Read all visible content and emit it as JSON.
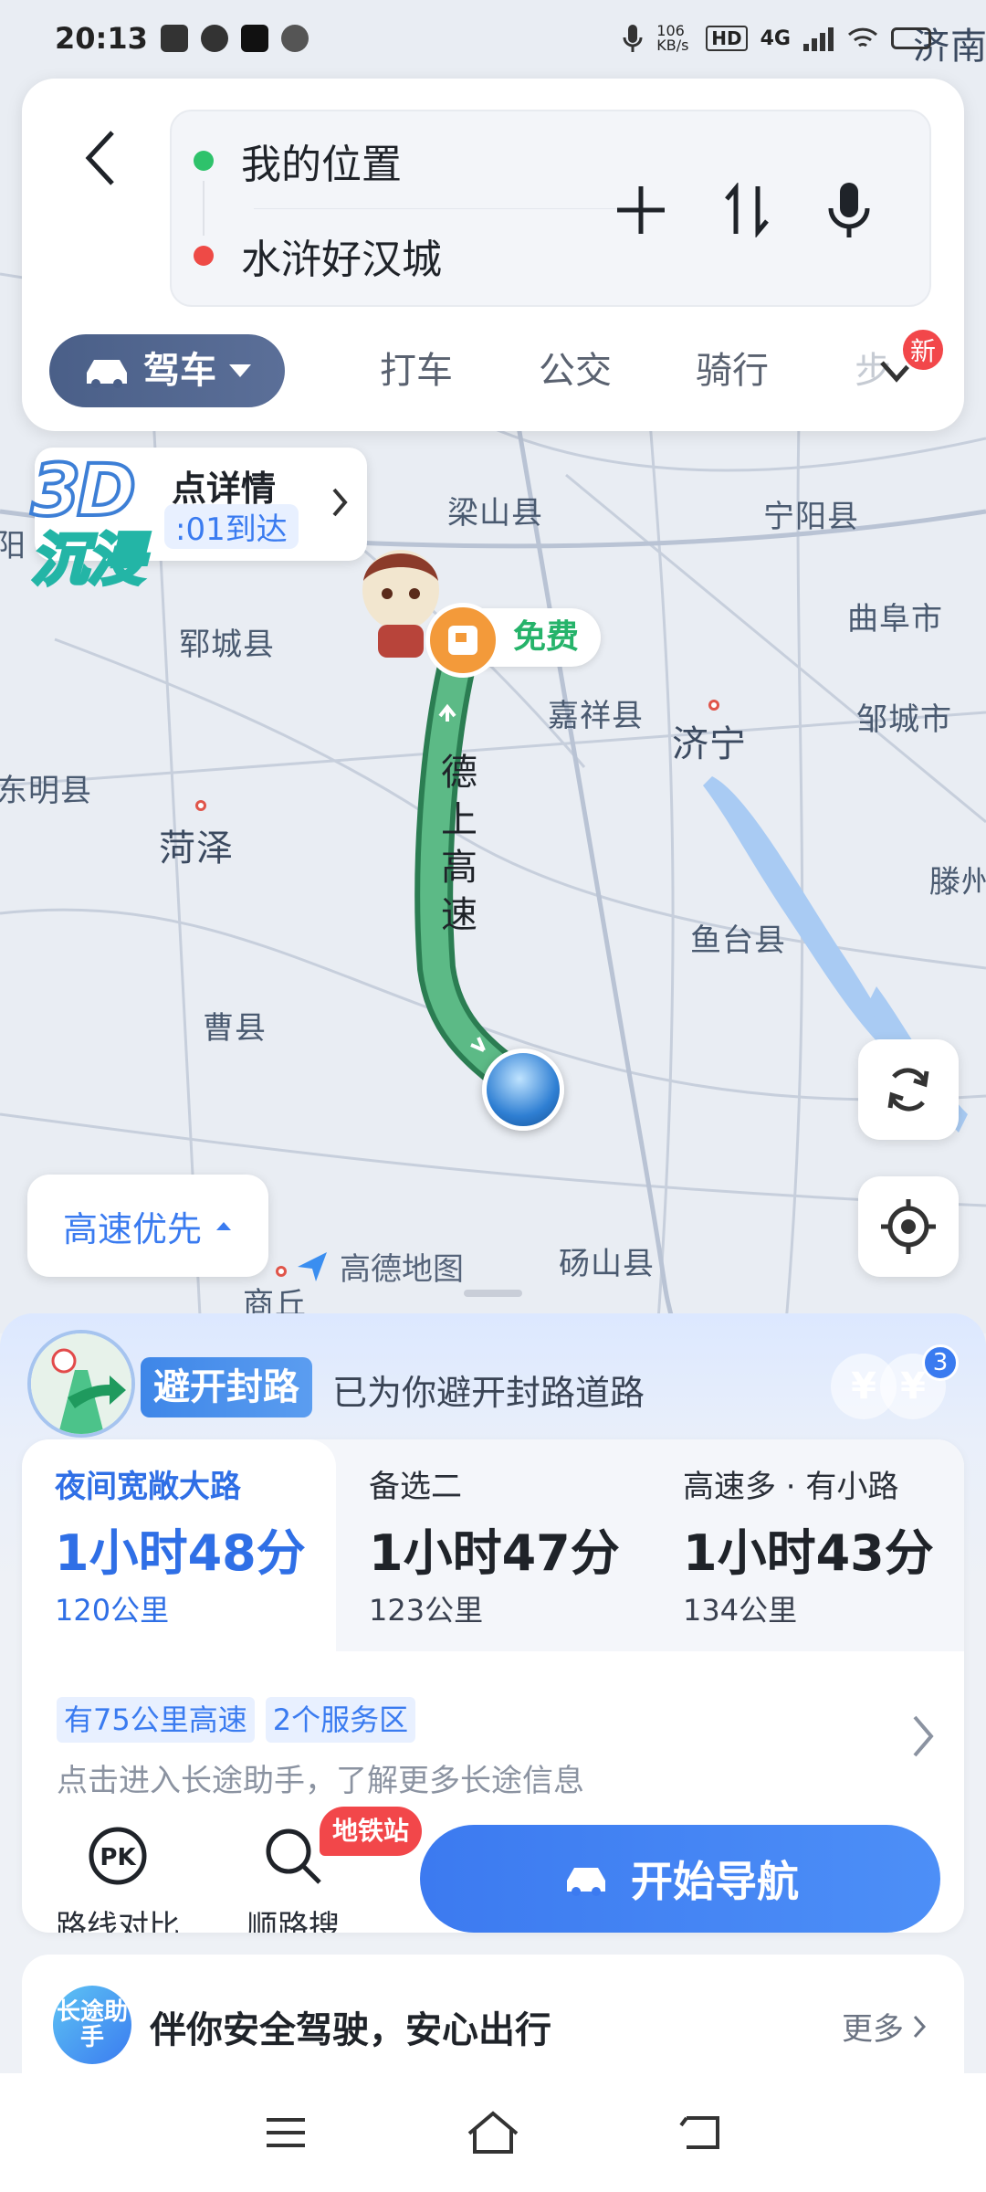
{
  "status_bar": {
    "time": "20:13",
    "net_speed": "106 KB/s",
    "hd": "HD",
    "signal": "4G"
  },
  "search": {
    "from": "我的位置",
    "to": "水浒好汉城",
    "tabs": [
      "驾车",
      "打车",
      "公交",
      "骑行",
      "步"
    ],
    "new_badge": "新"
  },
  "map": {
    "cities": [
      "梁山县",
      "宁阳县",
      "曲阜市",
      "郓城县",
      "嘉祥县",
      "济宁",
      "邹城市",
      "东明县",
      "菏泽",
      "鱼台县",
      "滕州",
      "曹县",
      "砀山县",
      "商丘",
      "阳",
      "济南"
    ],
    "road_name": "德上高速",
    "poi_card": {
      "title": "点详情",
      "eta": ":01到达"
    },
    "badge_3d": {
      "line1": "3D",
      "line2": "沉浸"
    },
    "free_tag": "免费",
    "route_pref": "高速优先",
    "logo": "高德地图"
  },
  "notice": {
    "pill": "避开封路",
    "text": "已为你避开封路道路",
    "count": "3",
    "yuan": "¥"
  },
  "routes": [
    {
      "name": "夜间宽敞大路",
      "time": "1小时48分",
      "dist": "120公里"
    },
    {
      "name": "备选二",
      "time": "1小时47分",
      "dist": "123公里"
    },
    {
      "name": "高速多 · 有小路",
      "time": "1小时43分",
      "dist": "134公里"
    }
  ],
  "route_tags": [
    "有75公里高速",
    "2个服务区"
  ],
  "hint": "点击进入长途助手，了解更多长途信息",
  "actions": {
    "compare": "路线对比",
    "search": "顺路搜",
    "metro_badge": "地铁站",
    "start": "开始导航"
  },
  "assistant": {
    "icon_text": "长途助手",
    "text": "伴你安全驾驶，安心出行",
    "more": "更多"
  },
  "colors": {
    "accent": "#3a7bf0",
    "route": "#3f9a6b",
    "alert": "#f2474a"
  }
}
